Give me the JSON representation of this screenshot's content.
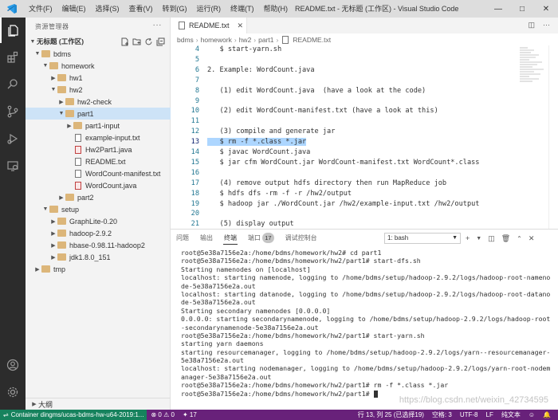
{
  "window": {
    "title": "README.txt - 无标题 (工作区) - Visual Studio Code",
    "menu": [
      "文件(F)",
      "编辑(E)",
      "选择(S)",
      "查看(V)",
      "转到(G)",
      "运行(R)",
      "终端(T)",
      "帮助(H)"
    ]
  },
  "sidebar": {
    "header": "资源管理器",
    "workspace": "无标题 (工作区)",
    "tree": [
      {
        "label": "bdms",
        "type": "folder",
        "depth": 0,
        "open": true
      },
      {
        "label": "homework",
        "type": "folder",
        "depth": 1,
        "open": true
      },
      {
        "label": "hw1",
        "type": "folder",
        "depth": 2,
        "open": false
      },
      {
        "label": "hw2",
        "type": "folder",
        "depth": 2,
        "open": true
      },
      {
        "label": "hw2-check",
        "type": "folder",
        "depth": 3,
        "open": false
      },
      {
        "label": "part1",
        "type": "folder",
        "depth": 3,
        "open": true,
        "selected": true
      },
      {
        "label": "part1-input",
        "type": "folder",
        "depth": 4,
        "open": false
      },
      {
        "label": "example-input.txt",
        "type": "txt",
        "depth": 4
      },
      {
        "label": "Hw2Part1.java",
        "type": "java",
        "depth": 4
      },
      {
        "label": "README.txt",
        "type": "txt",
        "depth": 4
      },
      {
        "label": "WordCount-manifest.txt",
        "type": "txt",
        "depth": 4
      },
      {
        "label": "WordCount.java",
        "type": "java",
        "depth": 4
      },
      {
        "label": "part2",
        "type": "folder",
        "depth": 3,
        "open": false
      },
      {
        "label": "setup",
        "type": "folder",
        "depth": 1,
        "open": true
      },
      {
        "label": "GraphLite-0.20",
        "type": "folder",
        "depth": 2,
        "open": false
      },
      {
        "label": "hadoop-2.9.2",
        "type": "folder",
        "depth": 2,
        "open": false
      },
      {
        "label": "hbase-0.98.11-hadoop2",
        "type": "folder",
        "depth": 2,
        "open": false
      },
      {
        "label": "jdk1.8.0_151",
        "type": "folder",
        "depth": 2,
        "open": false
      },
      {
        "label": "tmp",
        "type": "folder",
        "depth": 0,
        "open": false
      }
    ],
    "outline": "大纲"
  },
  "editor": {
    "tab": "README.txt",
    "breadcrumb": [
      "bdms",
      "homework",
      "hw2",
      "part1",
      "README.txt"
    ],
    "current_line": 13,
    "lines": [
      {
        "n": "4",
        "text": "   $ start-yarn.sh"
      },
      {
        "n": "5",
        "text": ""
      },
      {
        "n": "6",
        "text": "2. Example: WordCount.java"
      },
      {
        "n": "7",
        "text": ""
      },
      {
        "n": "8",
        "text": "   (1) edit WordCount.java  (have a look at the code)"
      },
      {
        "n": "9",
        "text": ""
      },
      {
        "n": "10",
        "text": "   (2) edit WordCount-manifest.txt (have a look at this)"
      },
      {
        "n": "11",
        "text": ""
      },
      {
        "n": "12",
        "text": "   (3) compile and generate jar"
      },
      {
        "n": "13",
        "text": "   $ rm -f *.class *.jar"
      },
      {
        "n": "14",
        "text": "   $ javac WordCount.java"
      },
      {
        "n": "15",
        "text": "   $ jar cfm WordCount.jar WordCount-manifest.txt WordCount*.class"
      },
      {
        "n": "16",
        "text": ""
      },
      {
        "n": "17",
        "text": "   (4) remove output hdfs directory then run MapReduce job"
      },
      {
        "n": "18",
        "text": "   $ hdfs dfs -rm -f -r /hw2/output"
      },
      {
        "n": "19",
        "text": "   $ hadoop jar ./WordCount.jar /hw2/example-input.txt /hw2/output"
      },
      {
        "n": "20",
        "text": ""
      },
      {
        "n": "21",
        "text": "   (5) display output"
      }
    ]
  },
  "panel": {
    "tabs": [
      "问题",
      "输出",
      "终端",
      "端口",
      "调试控制台"
    ],
    "active_tab": "终端",
    "ports_badge": "17",
    "terminal_select": "1: bash",
    "terminal_lines": [
      "root@5e38a7156e2a:/home/bdms/homework/hw2# cd part1",
      "root@5e38a7156e2a:/home/bdms/homework/hw2/part1# start-dfs.sh",
      "Starting namenodes on [localhost]",
      "localhost: starting namenode, logging to /home/bdms/setup/hadoop-2.9.2/logs/hadoop-root-nameno",
      "de-5e38a7156e2a.out",
      "localhost: starting datanode, logging to /home/bdms/setup/hadoop-2.9.2/logs/hadoop-root-datano",
      "de-5e38a7156e2a.out",
      "Starting secondary namenodes [0.0.0.0]",
      "0.0.0.0: starting secondarynamenode, logging to /home/bdms/setup/hadoop-2.9.2/logs/hadoop-root",
      "-secondarynamenode-5e38a7156e2a.out",
      "root@5e38a7156e2a:/home/bdms/homework/hw2/part1# start-yarn.sh",
      "starting yarn daemons",
      "starting resourcemanager, logging to /home/bdms/setup/hadoop-2.9.2/logs/yarn--resourcemanager-",
      "5e38a7156e2a.out",
      "localhost: starting nodemanager, logging to /home/bdms/setup/hadoop-2.9.2/logs/yarn-root-nodem",
      "anager-5e38a7156e2a.out",
      "root@5e38a7156e2a:/home/bdms/homework/hw2/part1# rm -f *.class *.jar",
      "root@5e38a7156e2a:/home/bdms/homework/hw2/part1# "
    ]
  },
  "statusbar": {
    "remote": "Container dingms/ucas-bdms-hw-u64-2019:1...",
    "errors": "0",
    "warnings": "0",
    "ports": "17",
    "position": "行 13, 列 25 (已选择19)",
    "spaces": "空格: 3",
    "encoding": "UTF-8",
    "eol": "LF",
    "language": "纯文本",
    "watermark": "https://blog.csdn.net/weixin_42734595"
  },
  "colors": {
    "statusbar": "#68217a",
    "remote": "#16825d",
    "activitybar": "#2c2c2c",
    "folder": "#dcb67a"
  }
}
